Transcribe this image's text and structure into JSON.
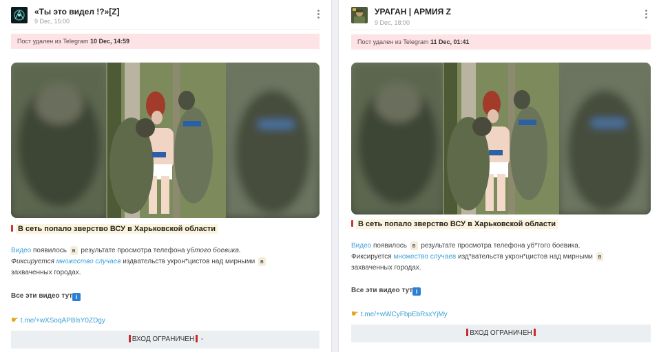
{
  "posts": [
    {
      "channel": "«Ты это видел !?»[Z]",
      "date": "9 Dec, 15:00",
      "deleted_prefix": "Пост удален из Telegram ",
      "deleted_when": "10 Dec, 14:59",
      "headline": "В сеть попало зверство ВСУ в Харьковской области",
      "p1_link": "Видео",
      "p1_a": " появилось ",
      "p1_chip": "в",
      "p1_b": " результате просмотра телефона уб",
      "p1_ital": "того боевика.",
      "p2_ital": "Фиксируется ",
      "p2_link": "множество случаев",
      "p2_a": " издвательств укрон*цистов над мирными ",
      "p2_chip": "в",
      "p3": "захваченных городах.",
      "all_videos": "Все эти видео тут",
      "info_glyph": "i",
      "tme_link": "t.me/+wXSoqAPBlsY0ZDgy",
      "entry_label": "ВХОД ОГРАНИЧЕН",
      "entry_suffix": " -"
    },
    {
      "channel": "УРАГАН | АРМИЯ Z",
      "date": "9 Dec, 18:00",
      "deleted_prefix": "Пост удален из Telegram ",
      "deleted_when": "11 Dec, 01:41",
      "headline": "В сеть попало зверство ВСУ в Харьковской области",
      "p1_link": "Видео",
      "p1_a": " появилось ",
      "p1_chip": "в",
      "p1_b": " результате просмотра телефона уб*того боевика.",
      "p2_a0": "Фиксируется ",
      "p2_link": "множество случаев",
      "p2_a": " изд*вательств укрон*цистов над мирными ",
      "p2_chip": "в",
      "p3": "захваченных городах.",
      "all_videos": "Все эти видео тут",
      "info_glyph": "i",
      "tme_link": "t.me/+wWCyFbpEbRsxYjMy",
      "entry_label": "ВХОД ОГРАНИЧЕН"
    }
  ],
  "colors": {
    "link": "#3a9fd6",
    "deleted_bg": "#fde3e6",
    "accent_red": "#d0342c"
  },
  "icons": [
    "channel-avatar",
    "kebab-menu-icon",
    "exclamation-icon",
    "info-icon",
    "pointing-hand-icon"
  ]
}
